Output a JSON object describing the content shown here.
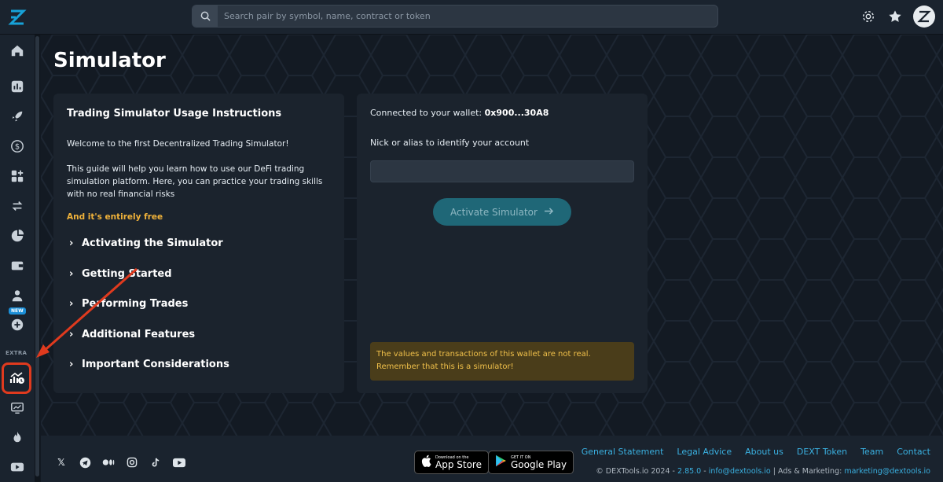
{
  "search": {
    "placeholder": "Search pair by symbol, name, contract or token"
  },
  "sidebar": {
    "items": [
      {
        "icon": "home-icon"
      },
      {
        "icon": "chart-icon"
      },
      {
        "icon": "rocket-icon"
      },
      {
        "icon": "dollar-icon"
      },
      {
        "icon": "apps-icon"
      },
      {
        "icon": "swap-icon"
      },
      {
        "icon": "pie-chart-icon"
      },
      {
        "icon": "wallet-icon"
      },
      {
        "icon": "user-icon"
      },
      {
        "icon": "plus-circle-icon"
      },
      {
        "icon": "simulator-icon"
      },
      {
        "icon": "monitor-chart-icon"
      },
      {
        "icon": "fire-icon"
      },
      {
        "icon": "youtube-icon"
      }
    ],
    "new_badge": "NEW",
    "extra_label": "EXTRA"
  },
  "page": {
    "title": "Simulator"
  },
  "instructions": {
    "title": "Trading Simulator Usage Instructions",
    "welcome": "Welcome to the first Decentralized Trading Simulator!",
    "guide": "This guide will help you learn how to use our DeFi trading simulation platform. Here, you can practice your trading skills with no real financial risks",
    "free": "And it's entirely free",
    "sections": [
      "Activating the Simulator",
      "Getting Started",
      "Performing Trades",
      "Additional Features",
      "Important Considerations"
    ]
  },
  "activation": {
    "wallet_prefix": "Connected to your wallet:",
    "wallet_address": "0x900...30A8",
    "nick_label": "Nick or alias to identify your account",
    "nick_value": "",
    "button_label": "Activate Simulator",
    "warning_line1": "The values and transactions of this wallet are not real.",
    "warning_line2": "Remember that this is a simulator!"
  },
  "footer": {
    "app_store_small": "Download on the",
    "app_store_big": "App Store",
    "google_play_small": "GET IT ON",
    "google_play_big": "Google Play",
    "links": [
      "General Statement",
      "Legal Advice",
      "About us",
      "DEXT Token",
      "Team",
      "Contact"
    ],
    "copyright_prefix": "© DEXTools.io 2024 -",
    "version": "2.85.0",
    "email": "info@dextools.io",
    "ads_label": "| Ads & Marketing:",
    "ads_email": "marketing@dextools.io"
  },
  "colors": {
    "accent": "#3ab0e0",
    "warning": "#f0c04a",
    "highlight": "#e03a1e"
  }
}
